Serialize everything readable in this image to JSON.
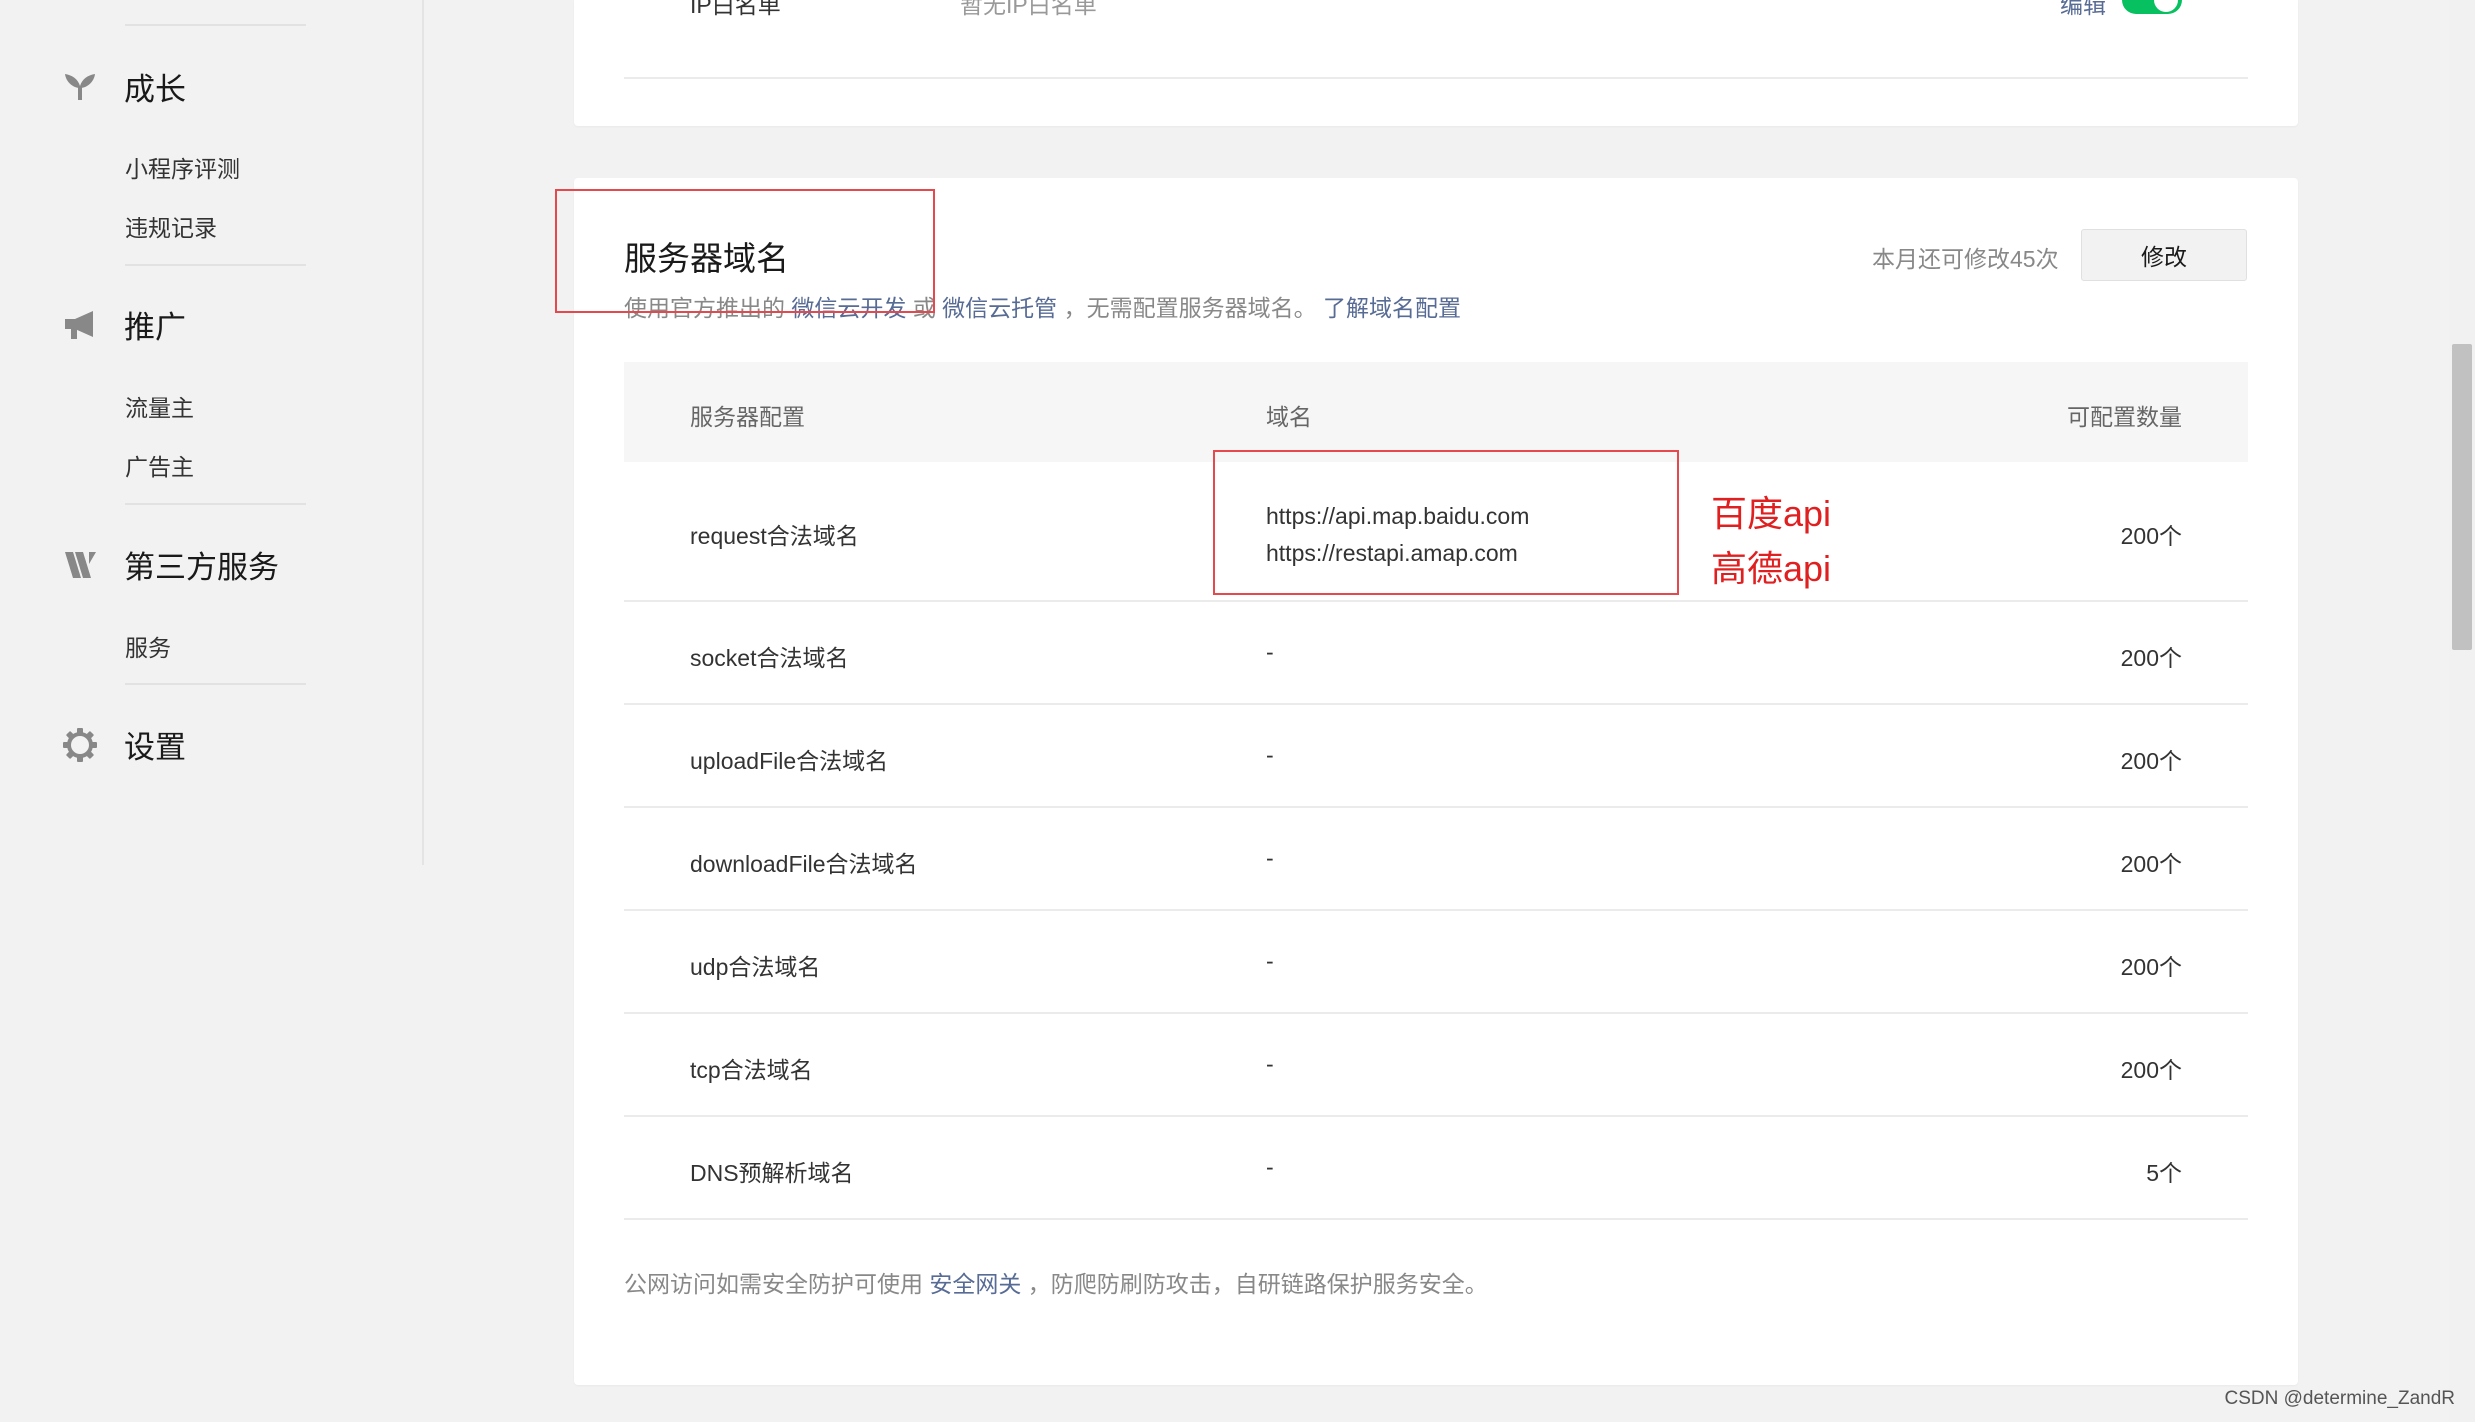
{
  "sidebar": {
    "groups": [
      {
        "title": "成长",
        "icon": "sprout-icon",
        "items": [
          "小程序评测",
          "违规记录"
        ]
      },
      {
        "title": "推广",
        "icon": "megaphone-icon",
        "items": [
          "流量主",
          "广告主"
        ]
      },
      {
        "title": "第三方服务",
        "icon": "third-party-icon",
        "items": [
          "服务"
        ]
      },
      {
        "title": "设置",
        "icon": "gear-icon",
        "items": []
      }
    ]
  },
  "top_card": {
    "row_label": "IP白名单",
    "row_value": "暂无IP白名单",
    "edit_label": "编辑"
  },
  "server_domain": {
    "title": "服务器域名",
    "desc_prefix": "使用官方推出的",
    "desc_link1": "微信云开发",
    "desc_or": "或",
    "desc_link2": "微信云托管",
    "desc_middle": "，无需配置服务器域名。",
    "desc_link3": "了解域名配置",
    "quota_text": "本月还可修改45次",
    "modify_label": "修改",
    "headers": {
      "config": "服务器配置",
      "domain": "域名",
      "count": "可配置数量"
    },
    "rows": [
      {
        "config": "request合法域名",
        "domains": [
          "https://api.map.baidu.com",
          "https://restapi.amap.com"
        ],
        "count": "200个"
      },
      {
        "config": "socket合法域名",
        "domains": [
          "-"
        ],
        "count": "200个"
      },
      {
        "config": "uploadFile合法域名",
        "domains": [
          "-"
        ],
        "count": "200个"
      },
      {
        "config": "downloadFile合法域名",
        "domains": [
          "-"
        ],
        "count": "200个"
      },
      {
        "config": "udp合法域名",
        "domains": [
          "-"
        ],
        "count": "200个"
      },
      {
        "config": "tcp合法域名",
        "domains": [
          "-"
        ],
        "count": "200个"
      },
      {
        "config": "DNS预解析域名",
        "domains": [
          "-"
        ],
        "count": "5个"
      }
    ],
    "footer_prefix": "公网访问如需安全防护可使用",
    "footer_link": "安全网关",
    "footer_suffix": "，防爬防刷防攻击，自研链路保护服务安全。"
  },
  "annotations": {
    "line1": "百度api",
    "line2": "高德api"
  },
  "watermark": "CSDN @determine_ZandR",
  "colors": {
    "link": "#576b95",
    "toggle_on": "#07c160",
    "annotation": "#e02020"
  }
}
